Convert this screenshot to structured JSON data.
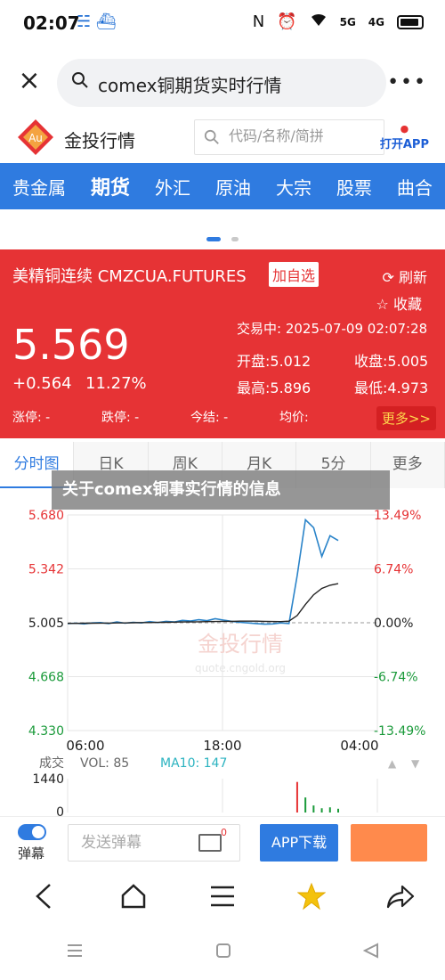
{
  "status_bar": {
    "time": "02:07",
    "left_icons": "☵ ⛴",
    "right_icons": [
      "N",
      "⏰",
      "5G",
      "4G"
    ]
  },
  "browser_search": {
    "query": "comex铜期货实时行情"
  },
  "site": {
    "name": "金投行情",
    "search_placeholder": "代码/名称/简拼",
    "open_app_label": "打开APP",
    "logo_text": "Au"
  },
  "nav_tabs": [
    {
      "label": "贵金属",
      "active": false
    },
    {
      "label": "期货",
      "active": true
    },
    {
      "label": "外汇",
      "active": false
    },
    {
      "label": "原油",
      "active": false
    },
    {
      "label": "大宗",
      "active": false
    },
    {
      "label": "股票",
      "active": false
    },
    {
      "label": "曲合",
      "active": false
    }
  ],
  "quote": {
    "title": "美精铜连续 CMZCUA.FUTURES",
    "add_watch": "加自选",
    "refresh": "刷新",
    "favorite": "收藏",
    "price": "5.569",
    "change": "+0.564",
    "change_pct": "11.27%",
    "trade_time_label": "交易中:",
    "trade_time": "2025-07-09 02:07:28",
    "open": "开盘:5.012",
    "prev_close": "收盘:5.005",
    "high": "最高:5.896",
    "low": "最低:4.973",
    "limit_up": "涨停:  -",
    "limit_down": "跌停:  -",
    "settle": "今结:  -",
    "avg": "均价:",
    "more": "更多>>"
  },
  "period_tabs": [
    {
      "label": "分时图",
      "active": true
    },
    {
      "label": "日K",
      "active": false
    },
    {
      "label": "周K",
      "active": false
    },
    {
      "label": "月K",
      "active": false
    },
    {
      "label": "5分",
      "active": false
    },
    {
      "label": "更多",
      "active": false
    }
  ],
  "overlay_banner": "关于comex铜事实行情的信息",
  "chart_data": {
    "type": "line",
    "y_ticks_left": [
      "5.680",
      "5.342",
      "5.005",
      "4.668",
      "4.330"
    ],
    "y_ticks_right": [
      "13.49%",
      "6.74%",
      "0.00%",
      "-6.74%",
      "-13.49%"
    ],
    "x_ticks": [
      "06:00",
      "18:00",
      "04:00"
    ],
    "ylim": [
      4.33,
      5.68
    ],
    "prev_close": 5.005,
    "series": [
      {
        "values": [
          5.0,
          5.002,
          4.998,
          5.004,
          5.006,
          5.0,
          5.01,
          5.002,
          5.008,
          5.004,
          5.012,
          5.006,
          5.014,
          5.01,
          5.02,
          5.016,
          5.024,
          5.018,
          5.03,
          5.022,
          5.014,
          5.008,
          5.004,
          5.0,
          4.996,
          4.998,
          5.004,
          5.0,
          5.3,
          5.65,
          5.6,
          5.42,
          5.55,
          5.52
        ]
      },
      {
        "values": [
          5.001,
          5.001,
          5.002,
          5.002,
          5.003,
          5.003,
          5.004,
          5.004,
          5.005,
          5.006,
          5.006,
          5.007,
          5.008,
          5.009,
          5.01,
          5.01,
          5.011,
          5.012,
          5.013,
          5.014,
          5.014,
          5.015,
          5.015,
          5.015,
          5.014,
          5.013,
          5.012,
          5.015,
          5.05,
          5.12,
          5.18,
          5.22,
          5.24,
          5.25
        ]
      }
    ],
    "volume": {
      "label": "成交",
      "vol_label": "VOL: 85",
      "ma_label": "MA10: 147",
      "y_ticks": [
        "1440",
        "0"
      ],
      "bars": [
        0,
        0,
        0,
        0,
        0,
        0,
        0,
        0,
        0,
        0,
        0,
        0,
        0,
        0,
        0,
        0,
        0,
        0,
        0,
        0,
        0,
        0,
        0,
        0,
        0,
        0,
        0,
        0,
        1300,
        640,
        300,
        180,
        220,
        160
      ]
    },
    "watermark": "金投行情",
    "watermark_url": "quote.cngold.org",
    "colors": {
      "line": "#2b84c9",
      "avg": "#222222",
      "up": "#e63335",
      "down": "#1a9a3a",
      "grid": "#e6e6e6"
    }
  },
  "compose": {
    "danmu_label": "弹幕",
    "input_placeholder": "发送弹幕",
    "message_count": "0",
    "app_download": "APP下载"
  },
  "browser_nav": [
    "back-icon",
    "home-icon",
    "menu-icon",
    "star-icon",
    "share-icon"
  ],
  "system_nav": [
    "recents-icon",
    "home-square-icon",
    "back-triangle-icon"
  ]
}
